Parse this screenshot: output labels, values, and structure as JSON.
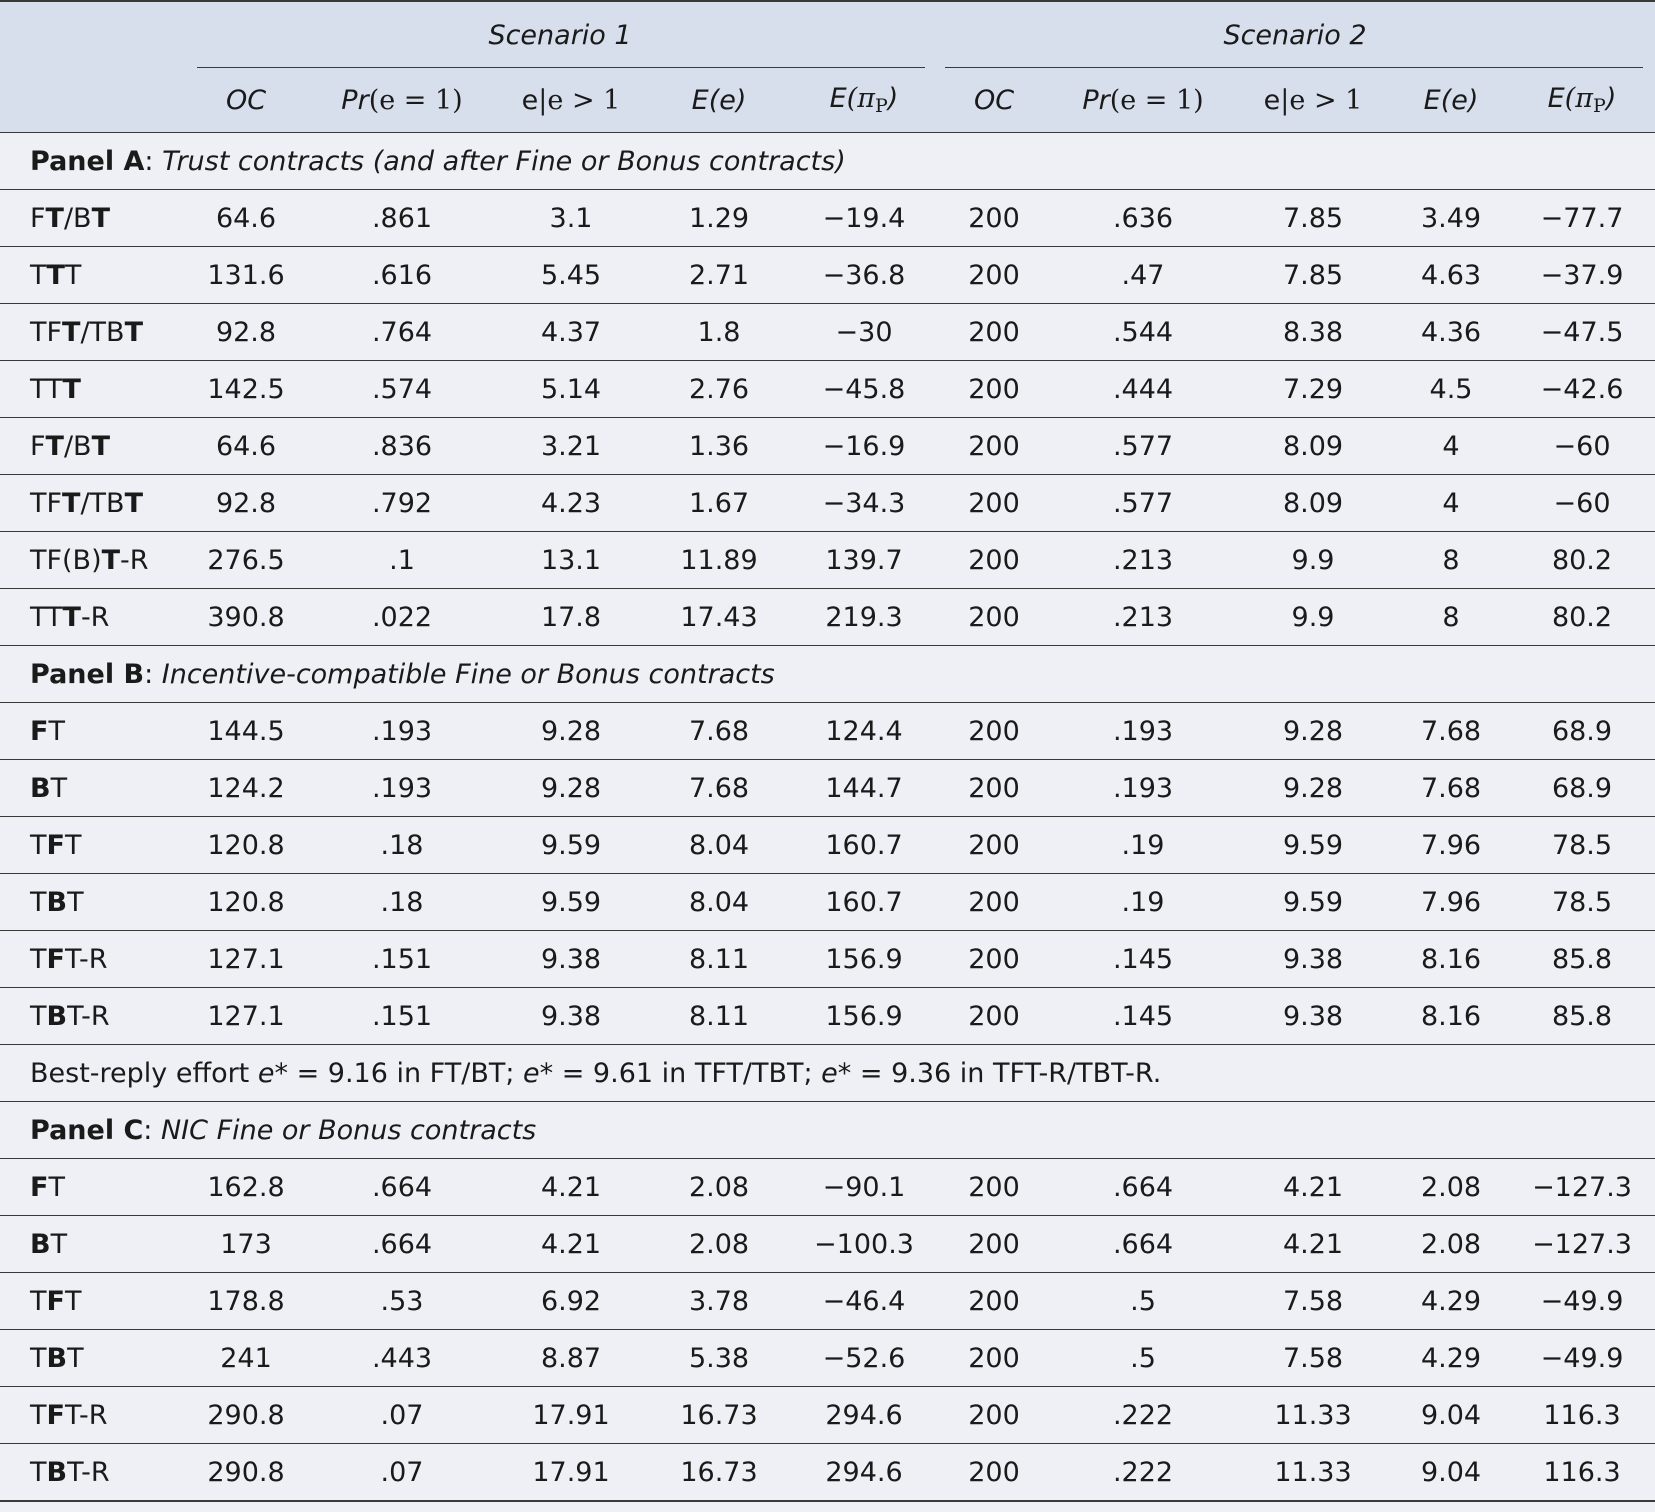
{
  "header": {
    "scenario_1": "Scenario 1",
    "scenario_2": "Scenario 2",
    "columns": {
      "oc": "OC",
      "pr_pre": "Pr",
      "pr_arg": "(e = 1)",
      "ee_e": "e",
      "ee_rest": "|e > 1",
      "ee_label": "E",
      "ee_arg": "(e)",
      "epi_label": "E",
      "epi_open": "(π",
      "epi_sub": "P",
      "epi_close": ")"
    }
  },
  "panel_a": {
    "label": "Panel A",
    "sep": ": ",
    "title": "Trust contracts (and after Fine or Bonus contracts)",
    "rows": [
      {
        "name": [
          [
            "F",
            false
          ],
          [
            "T",
            true
          ],
          [
            "/B",
            false
          ],
          [
            "T",
            true
          ]
        ],
        "v": [
          "64.6",
          ".861",
          "3.1",
          "1.29",
          "−19.4",
          "200",
          ".636",
          "7.85",
          "3.49",
          "−77.7"
        ]
      },
      {
        "name": [
          [
            "T",
            false
          ],
          [
            "T",
            true
          ],
          [
            "T",
            false
          ]
        ],
        "v": [
          "131.6",
          ".616",
          "5.45",
          "2.71",
          "−36.8",
          "200",
          ".47",
          "7.85",
          "4.63",
          "−37.9"
        ]
      },
      {
        "name": [
          [
            "TF",
            false
          ],
          [
            "T",
            true
          ],
          [
            "/TB",
            false
          ],
          [
            "T",
            true
          ]
        ],
        "v": [
          "92.8",
          ".764",
          "4.37",
          "1.8",
          "−30",
          "200",
          ".544",
          "8.38",
          "4.36",
          "−47.5"
        ]
      },
      {
        "name": [
          [
            "TT",
            false
          ],
          [
            "T",
            true
          ]
        ],
        "v": [
          "142.5",
          ".574",
          "5.14",
          "2.76",
          "−45.8",
          "200",
          ".444",
          "7.29",
          "4.5",
          "−42.6"
        ]
      },
      {
        "name": [
          [
            "F",
            false
          ],
          [
            "T",
            true
          ],
          [
            "/B",
            false
          ],
          [
            "T",
            true
          ]
        ],
        "v": [
          "64.6",
          ".836",
          "3.21",
          "1.36",
          "−16.9",
          "200",
          ".577",
          "8.09",
          "4",
          "−60"
        ]
      },
      {
        "name": [
          [
            "TF",
            false
          ],
          [
            "T",
            true
          ],
          [
            "/TB",
            false
          ],
          [
            "T",
            true
          ]
        ],
        "v": [
          "92.8",
          ".792",
          "4.23",
          "1.67",
          "−34.3",
          "200",
          ".577",
          "8.09",
          "4",
          "−60"
        ]
      },
      {
        "name": [
          [
            "TF(B)",
            false
          ],
          [
            "T",
            true
          ],
          [
            "-R",
            false
          ]
        ],
        "v": [
          "276.5",
          ".1",
          "13.1",
          "11.89",
          "139.7",
          "200",
          ".213",
          "9.9",
          "8",
          "80.2"
        ]
      },
      {
        "name": [
          [
            "TT",
            false
          ],
          [
            "T",
            true
          ],
          [
            "-R",
            false
          ]
        ],
        "v": [
          "390.8",
          ".022",
          "17.8",
          "17.43",
          "219.3",
          "200",
          ".213",
          "9.9",
          "8",
          "80.2"
        ]
      }
    ]
  },
  "panel_b": {
    "label": "Panel B",
    "sep": ": ",
    "title": "Incentive-compatible Fine or Bonus contracts",
    "rows": [
      {
        "name": [
          [
            "F",
            true
          ],
          [
            "T",
            false
          ]
        ],
        "v": [
          "144.5",
          ".193",
          "9.28",
          "7.68",
          "124.4",
          "200",
          ".193",
          "9.28",
          "7.68",
          "68.9"
        ]
      },
      {
        "name": [
          [
            "B",
            true
          ],
          [
            "T",
            false
          ]
        ],
        "v": [
          "124.2",
          ".193",
          "9.28",
          "7.68",
          "144.7",
          "200",
          ".193",
          "9.28",
          "7.68",
          "68.9"
        ]
      },
      {
        "name": [
          [
            "T",
            false
          ],
          [
            "F",
            true
          ],
          [
            "T",
            false
          ]
        ],
        "v": [
          "120.8",
          ".18",
          "9.59",
          "8.04",
          "160.7",
          "200",
          ".19",
          "9.59",
          "7.96",
          "78.5"
        ]
      },
      {
        "name": [
          [
            "T",
            false
          ],
          [
            "B",
            true
          ],
          [
            "T",
            false
          ]
        ],
        "v": [
          "120.8",
          ".18",
          "9.59",
          "8.04",
          "160.7",
          "200",
          ".19",
          "9.59",
          "7.96",
          "78.5"
        ]
      },
      {
        "name": [
          [
            "T",
            false
          ],
          [
            "F",
            true
          ],
          [
            "T-R",
            false
          ]
        ],
        "v": [
          "127.1",
          ".151",
          "9.38",
          "8.11",
          "156.9",
          "200",
          ".145",
          "9.38",
          "8.16",
          "85.8"
        ]
      },
      {
        "name": [
          [
            "T",
            false
          ],
          [
            "B",
            true
          ],
          [
            "T-R",
            false
          ]
        ],
        "v": [
          "127.1",
          ".151",
          "9.38",
          "8.11",
          "156.9",
          "200",
          ".145",
          "9.38",
          "8.16",
          "85.8"
        ]
      }
    ],
    "note": {
      "p1": "Best-reply effort ",
      "e1": "e",
      "s1": "* = 9.16 in FT/BT; ",
      "e2": "e",
      "s2": "* = 9.61 in TFT/TBT; ",
      "e3": "e",
      "s3": "* = 9.36 in TFT-R/TBT-R."
    }
  },
  "panel_c": {
    "label": "Panel C",
    "sep": ": ",
    "title": "NIC Fine or Bonus contracts",
    "rows": [
      {
        "name": [
          [
            "F",
            true
          ],
          [
            "T",
            false
          ]
        ],
        "v": [
          "162.8",
          ".664",
          "4.21",
          "2.08",
          "−90.1",
          "200",
          ".664",
          "4.21",
          "2.08",
          "−127.3"
        ]
      },
      {
        "name": [
          [
            "B",
            true
          ],
          [
            "T",
            false
          ]
        ],
        "v": [
          "173",
          ".664",
          "4.21",
          "2.08",
          "−100.3",
          "200",
          ".664",
          "4.21",
          "2.08",
          "−127.3"
        ]
      },
      {
        "name": [
          [
            "T",
            false
          ],
          [
            "F",
            true
          ],
          [
            "T",
            false
          ]
        ],
        "v": [
          "178.8",
          ".53",
          "6.92",
          "3.78",
          "−46.4",
          "200",
          ".5",
          "7.58",
          "4.29",
          "−49.9"
        ]
      },
      {
        "name": [
          [
            "T",
            false
          ],
          [
            "B",
            true
          ],
          [
            "T",
            false
          ]
        ],
        "v": [
          "241",
          ".443",
          "8.87",
          "5.38",
          "−52.6",
          "200",
          ".5",
          "7.58",
          "4.29",
          "−49.9"
        ]
      },
      {
        "name": [
          [
            "T",
            false
          ],
          [
            "F",
            true
          ],
          [
            "T-R",
            false
          ]
        ],
        "v": [
          "290.8",
          ".07",
          "17.91",
          "16.73",
          "294.6",
          "200",
          ".222",
          "11.33",
          "9.04",
          "116.3"
        ]
      },
      {
        "name": [
          [
            "T",
            false
          ],
          [
            "B",
            true
          ],
          [
            "T-R",
            false
          ]
        ],
        "v": [
          "290.8",
          ".07",
          "17.91",
          "16.73",
          "294.6",
          "200",
          ".222",
          "11.33",
          "9.04",
          "116.3"
        ]
      }
    ]
  }
}
